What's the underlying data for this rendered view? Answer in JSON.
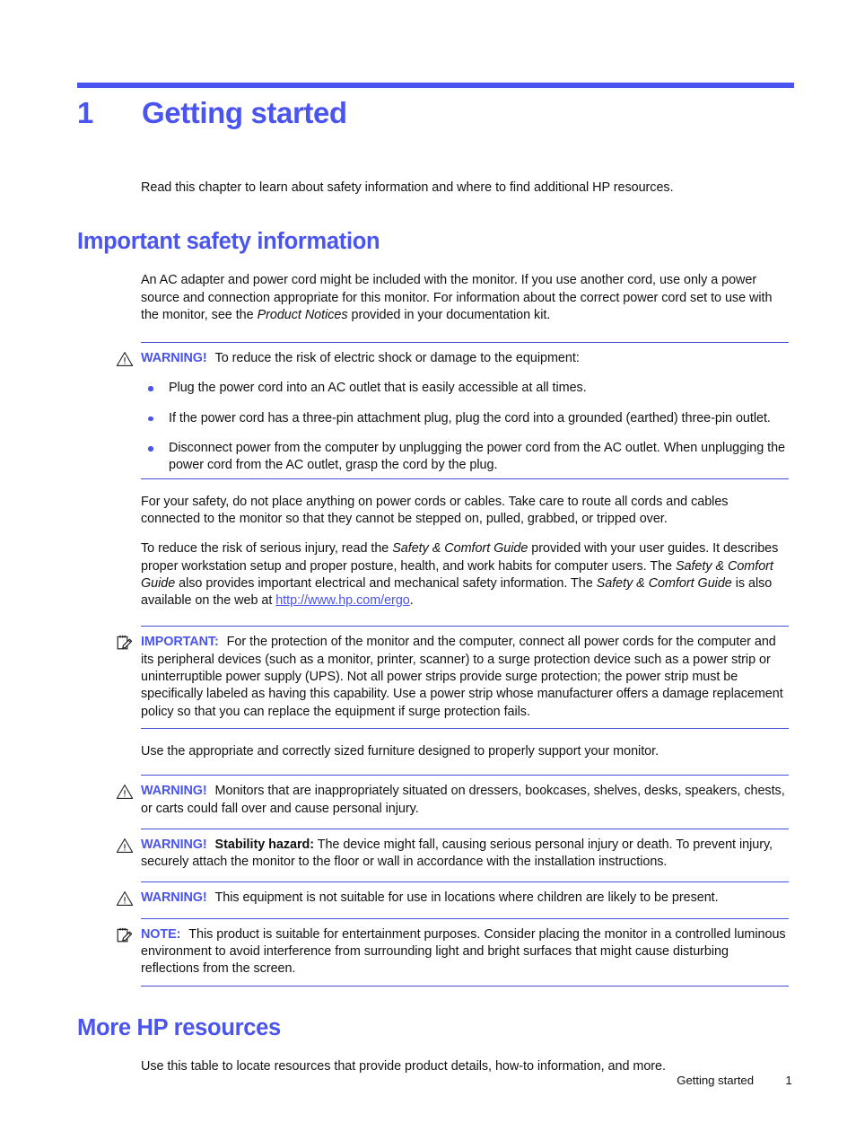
{
  "document": {
    "chapter_number": "1",
    "chapter_title": "Getting started",
    "accent_color": "#4a54ef",
    "text_color": "#121212",
    "intro": "Read this chapter to learn about safety information and where to find additional HP resources."
  },
  "sections": {
    "safety": {
      "heading": "Important safety information",
      "intro_paragraph": "An AC adapter and power cord might be included with the monitor. If you use another cord, use only a power source and connection appropriate for this monitor. For information about the correct power cord set to use with the monitor, see the ",
      "intro_italic": "Product Notices",
      "intro_paragraph_tail": " provided in your documentation kit.",
      "warning_shock": {
        "icon": "warning-triangle-icon",
        "label": "WARNING!",
        "text": "To reduce the risk of electric shock or damage to the equipment:",
        "bullets": [
          "Plug the power cord into an AC outlet that is easily accessible at all times.",
          "If the power cord has a three-pin attachment plug, plug the cord into a grounded (earthed) three-pin outlet.",
          "Disconnect power from the computer by unplugging the power cord from the AC outlet. When unplugging the power cord from the AC outlet, grasp the cord by the plug."
        ]
      },
      "safety_paragraph": "For your safety, do not place anything on power cords or cables. Take care to route all cords and cables connected to the monitor so that they cannot be stepped on, pulled, grabbed, or tripped over.",
      "comfort_guide": {
        "part1": "To reduce the risk of serious injury, read the ",
        "italic1": "Safety & Comfort Guide",
        "part2": " provided with your user guides. It describes proper workstation setup and proper posture, health, and work habits for computer users. The ",
        "italic2": "Safety & Comfort Guide",
        "part3": " also provides important electrical and mechanical safety information. The ",
        "italic3": "Safety & Comfort Guide",
        "part4": " is also available on the web at ",
        "link_text": "http://www.hp.com/ergo",
        "part5": "."
      },
      "important_surge": {
        "icon": "note-pencil-icon",
        "label": "IMPORTANT:",
        "text": "For the protection of the monitor and the computer, connect all power cords for the computer and its peripheral devices (such as a monitor, printer, scanner) to a surge protection device such as a power strip or uninterruptible power supply (UPS). Not all power strips provide surge protection; the power strip must be specifically labeled as having this capability. Use a power strip whose manufacturer offers a damage replacement policy so that you can replace the equipment if surge protection fails."
      },
      "furniture_paragraph": "Use the appropriate and correctly sized furniture designed to properly support your monitor.",
      "warning_furniture": {
        "icon": "warning-triangle-icon",
        "label": "WARNING!",
        "text": "Monitors that are inappropriately situated on dressers, bookcases, shelves, desks, speakers, chests, or carts could fall over and cause personal injury."
      },
      "warning_stability": {
        "icon": "warning-triangle-icon",
        "label": "WARNING!",
        "bold_lead": "Stability hazard:",
        "text": " The device might fall, causing serious personal injury or death. To prevent injury, securely attach the monitor to the floor or wall in accordance with the installation instructions."
      },
      "warning_children": {
        "icon": "warning-triangle-icon",
        "label": "WARNING!",
        "text": "This equipment is not suitable for use in locations where children are likely to be present."
      },
      "note_entertainment": {
        "icon": "note-pencil-icon",
        "label": "NOTE:",
        "text": "This product is suitable for entertainment purposes. Consider placing the monitor in a controlled luminous environment to avoid interference from surrounding light and bright surfaces that might cause disturbing reflections from the screen."
      }
    },
    "resources": {
      "heading": "More HP resources",
      "paragraph": "Use this table to locate resources that provide product details, how-to information, and more."
    }
  },
  "footer": {
    "chapter_label": "Getting started",
    "page_number": "1"
  }
}
